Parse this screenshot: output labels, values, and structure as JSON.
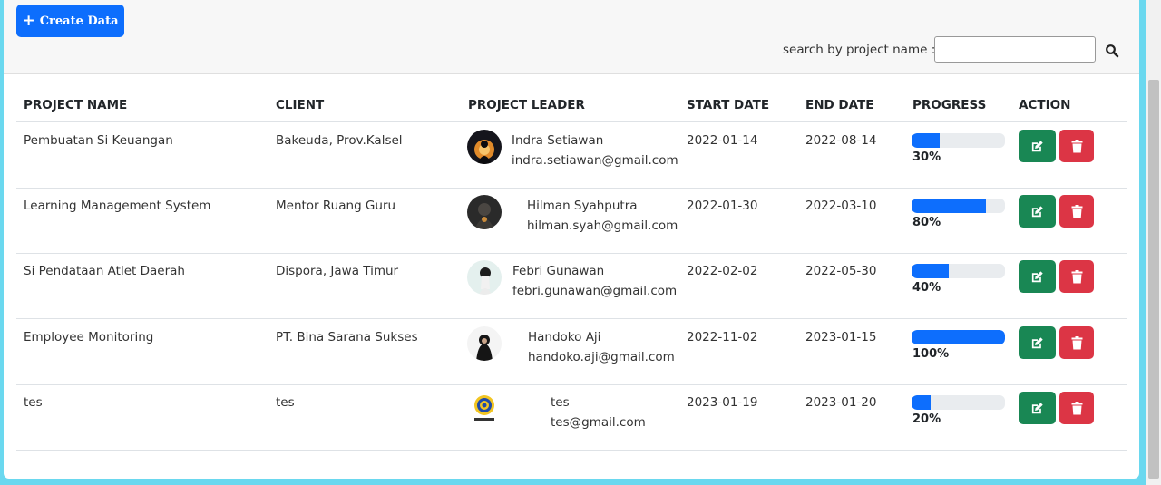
{
  "header": {
    "create_label": "Create Data",
    "search_label": "search by project name :",
    "search_value": "",
    "search_placeholder": ""
  },
  "table": {
    "columns": [
      "PROJECT NAME",
      "CLIENT",
      "PROJECT LEADER",
      "START DATE",
      "END DATE",
      "PROGRESS",
      "ACTION"
    ],
    "rows": [
      {
        "project": "Pembuatan Si Keuangan",
        "client": "Bakeuda, Prov.Kalsel",
        "leader": "Indra Setiawan",
        "email": "indra.setiawan@gmail.com",
        "start": "2022-01-14",
        "end": "2022-08-14",
        "progress": 30,
        "progress_label": "30%"
      },
      {
        "project": "Learning Management System",
        "client": "Mentor Ruang Guru",
        "leader": "Hilman Syahputra",
        "email": "hilman.syah@gmail.com",
        "start": "2022-01-30",
        "end": "2022-03-10",
        "progress": 80,
        "progress_label": "80%"
      },
      {
        "project": "Si Pendataan Atlet Daerah",
        "client": "Dispora, Jawa Timur",
        "leader": "Febri Gunawan",
        "email": "febri.gunawan@gmail.com",
        "start": "2022-02-02",
        "end": "2022-05-30",
        "progress": 40,
        "progress_label": "40%"
      },
      {
        "project": "Employee Monitoring",
        "client": "PT. Bina Sarana Sukses",
        "leader": "Handoko Aji",
        "email": "handoko.aji@gmail.com",
        "start": "2022-11-02",
        "end": "2023-01-15",
        "progress": 100,
        "progress_label": "100%"
      },
      {
        "project": "tes",
        "client": "tes",
        "leader": "tes",
        "email": "tes@gmail.com",
        "start": "2023-01-19",
        "end": "2023-01-20",
        "progress": 20,
        "progress_label": "20%"
      }
    ]
  },
  "icons": {
    "create": "plus-icon",
    "search": "search-icon",
    "edit": "edit-icon",
    "delete": "trash-icon"
  },
  "colors": {
    "primary": "#0d6efd",
    "success": "#198754",
    "danger": "#dc3545",
    "frame": "#6ad8ef"
  }
}
